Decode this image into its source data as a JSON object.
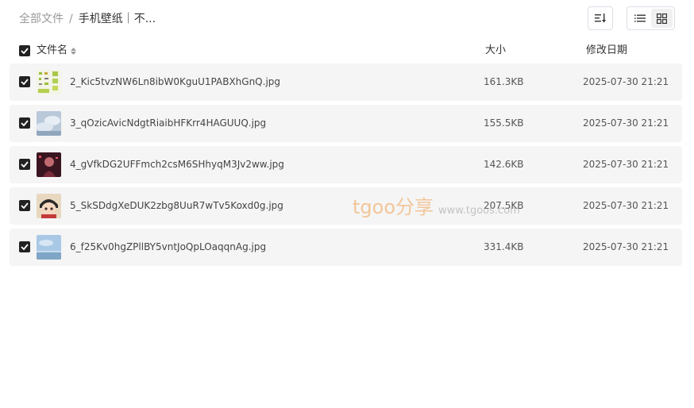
{
  "breadcrumb": {
    "root": "全部文件",
    "separator": "/",
    "current": "手机壁纸｜不..."
  },
  "toolbar": {
    "sort_icon": "sort-lines-icon",
    "list_view_icon": "list-view-icon",
    "grid_view_icon": "grid-view-icon"
  },
  "table": {
    "headers": {
      "name": "文件名",
      "size": "大小",
      "date": "修改日期"
    },
    "rows": [
      {
        "name": "2_Kic5tvzNW6Ln8ibW0KguU1PABXhGnQ.jpg",
        "size": "161.3KB",
        "date": "2025-07-30 21:21",
        "checked": true
      },
      {
        "name": "3_qOzicAvicNdgtRiaibHFKrr4HAGUUQ.jpg",
        "size": "155.5KB",
        "date": "2025-07-30 21:21",
        "checked": true
      },
      {
        "name": "4_gVfkDG2UFFmch2csM6SHhyqM3Jv2ww.jpg",
        "size": "142.6KB",
        "date": "2025-07-30 21:21",
        "checked": true
      },
      {
        "name": "5_SkSDdgXeDUK2zbg8UuR7wTv5Koxd0g.jpg",
        "size": "207.5KB",
        "date": "2025-07-30 21:21",
        "checked": true
      },
      {
        "name": "6_f25Kv0hgZPllBY5vntJoQpLOaqqnAg.jpg",
        "size": "331.4KB",
        "date": "2025-07-30 21:21",
        "checked": true
      }
    ]
  },
  "watermark": {
    "brand": "tgoo分享",
    "url": "www.tgoos.com"
  },
  "colors": {
    "checkbox": "#222222",
    "row_bg": "#f5f5f5",
    "watermark": "#f0a050"
  }
}
